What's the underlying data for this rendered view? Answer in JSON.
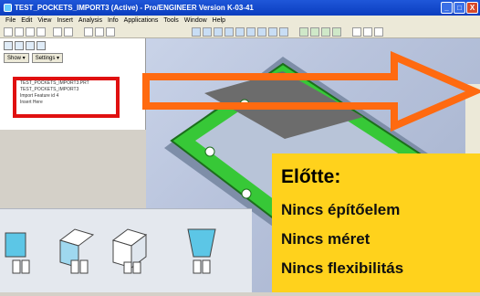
{
  "window": {
    "title": "TEST_POCKETS_IMPORT3 (Active) - Pro/ENGINEER Version K-03-41",
    "minimize": "_",
    "maximize": "□",
    "close": "X"
  },
  "menubar": {
    "items": [
      "File",
      "Edit",
      "View",
      "Insert",
      "Analysis",
      "Info",
      "Applications",
      "Tools",
      "Window",
      "Help"
    ]
  },
  "navigator": {
    "tabs": [
      "Show ▾",
      "Settings ▾"
    ],
    "tree": [
      "TEST_POCKETS_IMPORT3.PRT",
      "TEST_POCKETS_IMPORT3",
      "Import Feature id 4",
      "Insert Here"
    ]
  },
  "callout": {
    "heading": "Előtte:",
    "lines": [
      "Nincs építőelem",
      "Nincs méret",
      "Nincs flexibilitás"
    ]
  },
  "colors": {
    "arrow": "#ff6a10",
    "callout_bg": "#ffd21c",
    "highlight": "#e01010",
    "part_green": "#37c837"
  },
  "palette": {
    "icons": [
      "extrude-pocket-icon",
      "offset-pocket-icon",
      "box-pocket-icon",
      "cylinder-pocket-icon"
    ]
  }
}
